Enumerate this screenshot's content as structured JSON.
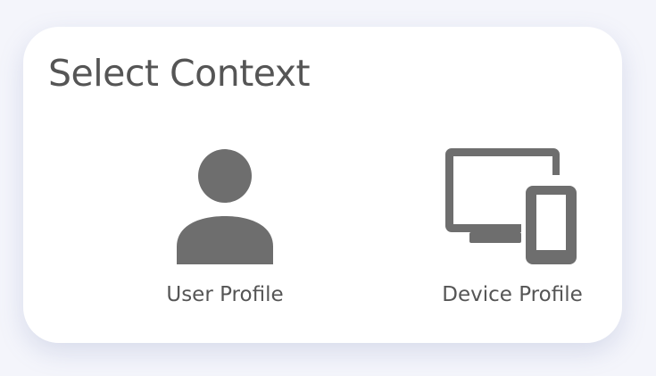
{
  "dialog": {
    "title": "Select Context",
    "options": [
      {
        "label": "User Profile",
        "icon": "user-icon"
      },
      {
        "label": "Device Profile",
        "icon": "devices-icon"
      }
    ]
  },
  "colors": {
    "background": "#f4f5fb",
    "card": "#ffffff",
    "text": "#555555",
    "icon": "#6e6e6e"
  }
}
